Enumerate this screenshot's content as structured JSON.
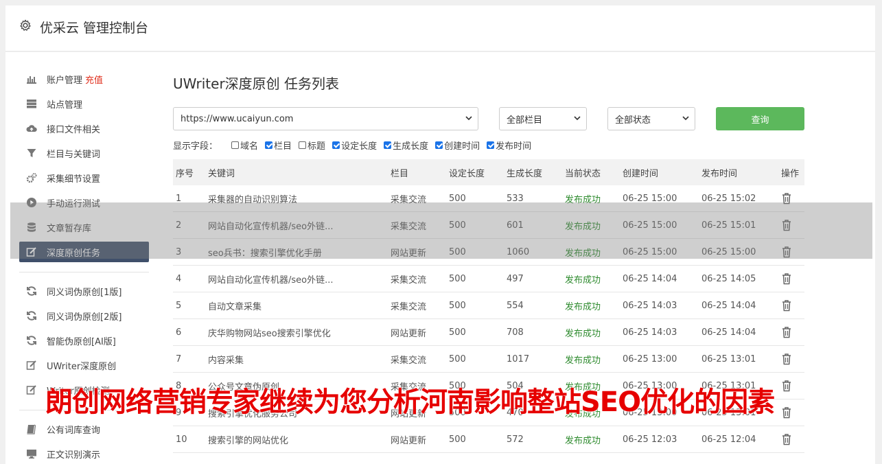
{
  "app": {
    "title": "优采云 管理控制台"
  },
  "sidebar": {
    "items": [
      {
        "label": "账户管理",
        "badge": "充值",
        "icon": "bar-chart-icon"
      },
      {
        "label": "站点管理",
        "icon": "server-icon"
      },
      {
        "label": "接口文件相关",
        "icon": "cloud-upload-icon"
      },
      {
        "label": "栏目与关键词",
        "icon": "filter-icon"
      },
      {
        "label": "采集细节设置",
        "icon": "cogs-icon"
      },
      {
        "label": "手动运行测试",
        "icon": "play-circle-icon"
      },
      {
        "label": "文章暂存库",
        "icon": "database-icon"
      },
      {
        "label": "深度原创任务",
        "icon": "edit-icon",
        "active": true
      },
      {
        "label": "同义词伪原创[1版]",
        "icon": "refresh-icon"
      },
      {
        "label": "同义词伪原创[2版]",
        "icon": "refresh-icon"
      },
      {
        "label": "智能伪原创[AI版]",
        "icon": "refresh-icon"
      },
      {
        "label": "UWriter深度原创",
        "icon": "edit-icon"
      },
      {
        "label": "Writer原创检测",
        "icon": "edit-icon"
      },
      {
        "label": "公有词库查询",
        "icon": "book-icon"
      },
      {
        "label": "正文识别演示",
        "icon": "monitor-icon"
      }
    ]
  },
  "main": {
    "title": "UWriter深度原创 任务列表",
    "filters": {
      "site": "https://www.ucaiyun.com",
      "column": "全部栏目",
      "status": "全部状态",
      "query_label": "查询"
    },
    "fields_label": "显示字段：",
    "fields": [
      {
        "label": "域名",
        "checked": false
      },
      {
        "label": "栏目",
        "checked": true
      },
      {
        "label": "标题",
        "checked": false
      },
      {
        "label": "设定长度",
        "checked": true
      },
      {
        "label": "生成长度",
        "checked": true
      },
      {
        "label": "创建时间",
        "checked": true
      },
      {
        "label": "发布时间",
        "checked": true
      }
    ],
    "table": {
      "headers": [
        "序号",
        "关键词",
        "栏目",
        "设定长度",
        "生成长度",
        "当前状态",
        "创建时间",
        "发布时间",
        "操作"
      ],
      "rows": [
        [
          "1",
          "采集器的自动识别算法",
          "采集交流",
          "500",
          "533",
          "发布成功",
          "06-25 15:00",
          "06-25 15:02"
        ],
        [
          "2",
          "网站自动化宣传机器/seo外链...",
          "采集交流",
          "500",
          "601",
          "发布成功",
          "06-25 15:00",
          "06-25 15:01"
        ],
        [
          "3",
          "seo兵书：搜索引擎优化手册",
          "网站更新",
          "500",
          "1060",
          "发布成功",
          "06-25 15:00",
          "06-25 15:00"
        ],
        [
          "4",
          "网站自动化宣传机器/seo外链...",
          "采集交流",
          "500",
          "497",
          "发布成功",
          "06-25 14:04",
          "06-25 14:05"
        ],
        [
          "5",
          "自动文章采集",
          "采集交流",
          "500",
          "554",
          "发布成功",
          "06-25 14:03",
          "06-25 14:04"
        ],
        [
          "6",
          "庆华购物网站seo搜索引擎优化",
          "网站更新",
          "500",
          "708",
          "发布成功",
          "06-25 14:03",
          "06-25 14:04"
        ],
        [
          "7",
          "内容采集",
          "采集交流",
          "500",
          "1017",
          "发布成功",
          "06-25 13:00",
          "06-25 13:01"
        ],
        [
          "8",
          "公众号文章伪原创",
          "采集交流",
          "500",
          "504",
          "发布成功",
          "06-25 13:00",
          "06-25 13:01"
        ],
        [
          "9",
          "搜索引擎优化服务公司",
          "网站更新",
          "500",
          "470",
          "发布成功",
          "06-25 13:00",
          "06-25 13:01"
        ],
        [
          "10",
          "搜索引擎的网站优化",
          "网站更新",
          "500",
          "572",
          "发布成功",
          "06-25 12:03",
          "06-25 12:04"
        ]
      ]
    }
  },
  "overlay": {
    "caption": "朗创网络营销专家继续为您分析河南影响整站SEO优化的因素"
  },
  "colors": {
    "accent_green": "#5cb85c",
    "active_nav": "#3f4f6a",
    "badge_red": "#e0301e",
    "caption_red": "#e60000"
  }
}
